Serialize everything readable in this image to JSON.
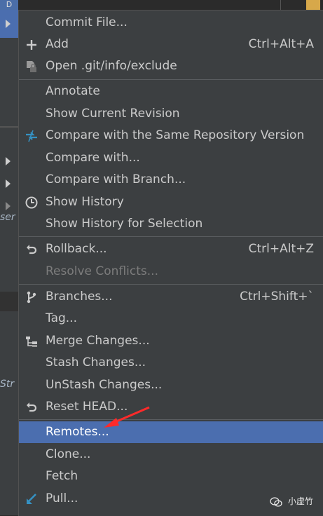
{
  "background": {
    "left_fragments": [
      "ser",
      "Str"
    ],
    "top_fragment": "D"
  },
  "menu": {
    "items": [
      {
        "label": "Commit File...",
        "shortcut": "",
        "icon": "none",
        "state": "normal"
      },
      {
        "label": "Add",
        "shortcut": "Ctrl+Alt+A",
        "icon": "plus-icon",
        "state": "normal"
      },
      {
        "label": "Open .git/info/exclude",
        "shortcut": "",
        "icon": "file-lock-icon",
        "state": "normal"
      },
      {
        "label": "Annotate",
        "shortcut": "",
        "icon": "none",
        "state": "normal"
      },
      {
        "label": "Show Current Revision",
        "shortcut": "",
        "icon": "none",
        "state": "normal"
      },
      {
        "label": "Compare with the Same Repository Version",
        "shortcut": "",
        "icon": "compare-icon",
        "state": "normal"
      },
      {
        "label": "Compare with...",
        "shortcut": "",
        "icon": "none",
        "state": "normal"
      },
      {
        "label": "Compare with Branch...",
        "shortcut": "",
        "icon": "none",
        "state": "normal"
      },
      {
        "label": "Show History",
        "shortcut": "",
        "icon": "clock-icon",
        "state": "normal"
      },
      {
        "label": "Show History for Selection",
        "shortcut": "",
        "icon": "none",
        "state": "normal"
      },
      {
        "label": "Rollback...",
        "shortcut": "Ctrl+Alt+Z",
        "icon": "undo-icon",
        "state": "normal"
      },
      {
        "label": "Resolve Conflicts...",
        "shortcut": "",
        "icon": "none",
        "state": "disabled"
      },
      {
        "label": "Branches...",
        "shortcut": "Ctrl+Shift+`",
        "icon": "branch-icon",
        "state": "normal"
      },
      {
        "label": "Tag...",
        "shortcut": "",
        "icon": "none",
        "state": "normal"
      },
      {
        "label": "Merge Changes...",
        "shortcut": "",
        "icon": "merge-icon",
        "state": "normal"
      },
      {
        "label": "Stash Changes...",
        "shortcut": "",
        "icon": "none",
        "state": "normal"
      },
      {
        "label": "UnStash Changes...",
        "shortcut": "",
        "icon": "none",
        "state": "normal"
      },
      {
        "label": "Reset HEAD...",
        "shortcut": "",
        "icon": "undo-icon",
        "state": "normal"
      },
      {
        "label": "Remotes...",
        "shortcut": "",
        "icon": "none",
        "state": "selected"
      },
      {
        "label": "Clone...",
        "shortcut": "",
        "icon": "none",
        "state": "normal"
      },
      {
        "label": "Fetch",
        "shortcut": "",
        "icon": "none",
        "state": "normal"
      },
      {
        "label": "Pull...",
        "shortcut": "",
        "icon": "pull-arrow-icon",
        "state": "normal"
      }
    ]
  },
  "annotation": {
    "arrow_color": "#ff2a2a"
  },
  "watermark": {
    "text": "小虚竹"
  },
  "colors": {
    "menu_bg": "#3c3f41",
    "selected_bg": "#4b6eaf",
    "text": "#cbcbcb",
    "disabled_text": "#7c7c7c",
    "blue_icon": "#3592c4"
  }
}
